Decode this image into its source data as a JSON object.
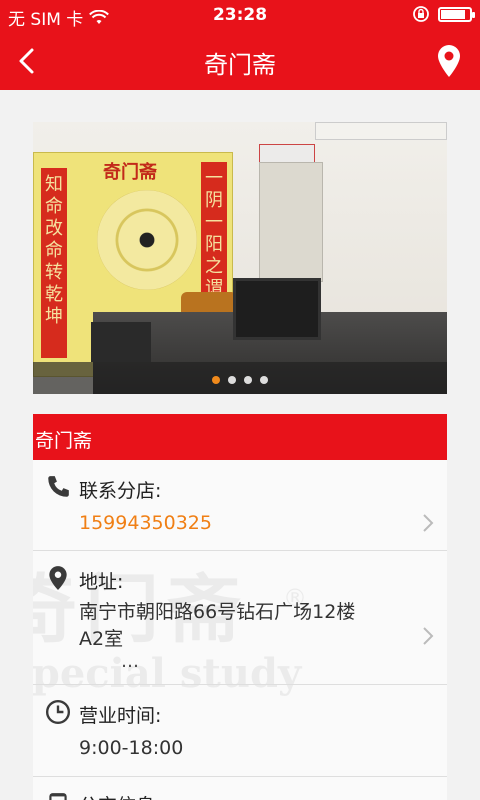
{
  "status_bar": {
    "carrier": "无 SIM 卡",
    "time": "23:28",
    "icons": [
      "wifi-icon",
      "rotation-lock-icon",
      "battery-icon"
    ]
  },
  "nav": {
    "title": "奇门斋",
    "back_icon": "chevron-left-icon",
    "location_icon": "map-pin-icon"
  },
  "gallery": {
    "page_count": 4,
    "active_index": 0,
    "photo_text": {
      "poster_title": "奇门斋",
      "left_couplet": "知命改命转乾坤",
      "right_couplet": "一阴一阳之谓道"
    }
  },
  "store": {
    "name": "奇门斋",
    "rows": [
      {
        "icon": "phone-icon",
        "label": "联系分店:",
        "value": "15994350325"
      },
      {
        "icon": "location-pin-icon",
        "label": "地址:",
        "value_line1": "南宁市朝阳路66号钻石广场12楼",
        "value_line2": "A2室",
        "more": "…"
      },
      {
        "icon": "clock-icon",
        "label": "营业时间:",
        "value": "9:00-18:00"
      },
      {
        "icon": "bus-icon",
        "label": "公交信息:"
      }
    ]
  },
  "watermark": {
    "cn": "奇门斋",
    "registered": "®",
    "en": "Special study"
  },
  "colors": {
    "brand_red": "#e8121a",
    "phone_orange": "#f07f14",
    "active_dot": "#f08a1c"
  }
}
